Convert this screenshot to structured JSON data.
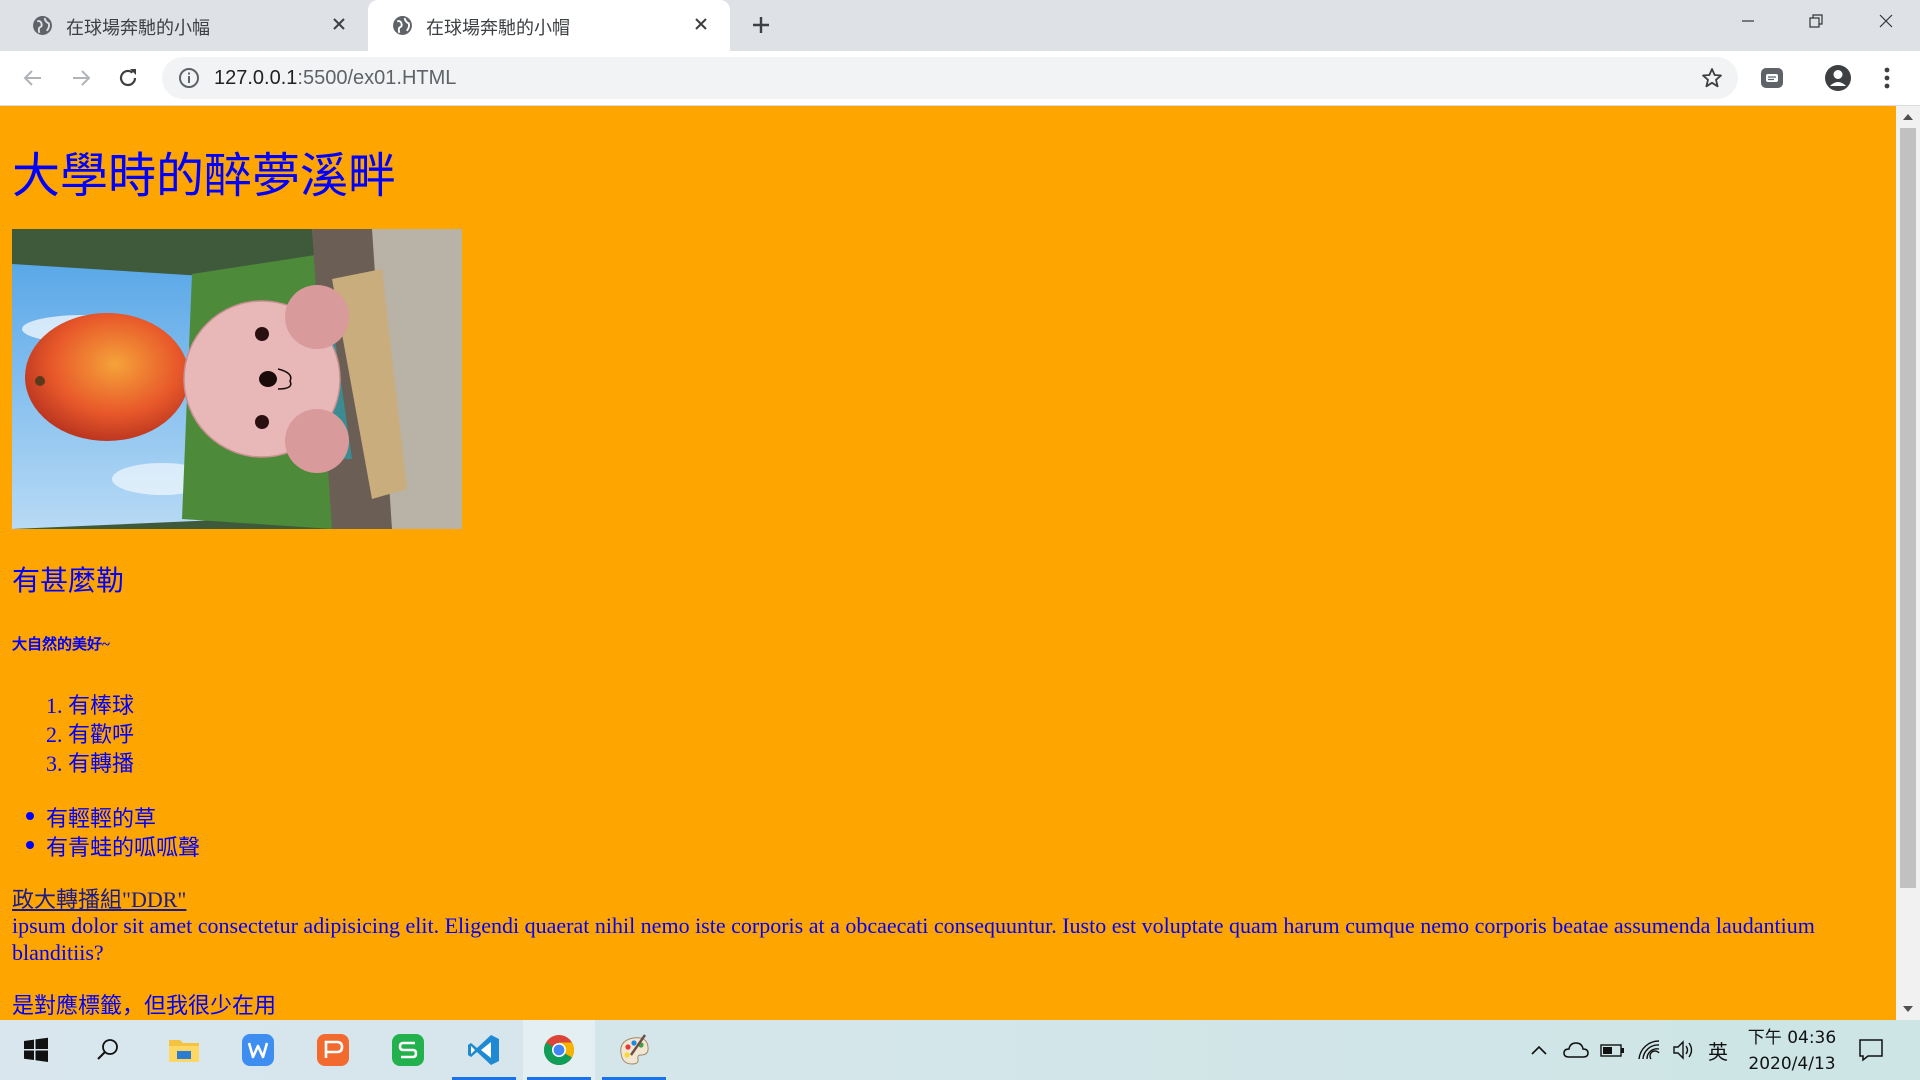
{
  "browser": {
    "tabs": [
      {
        "title": "在球場奔馳的小幅",
        "active": false
      },
      {
        "title": "在球場奔馳的小帽",
        "active": true
      }
    ],
    "url": {
      "host": "127.0.0.1",
      "rest": ":5500/ex01.HTML"
    }
  },
  "page": {
    "background": "#ffa500",
    "text_color": "#0000ff",
    "heading1": "大學時的醉夢溪畔",
    "heading2": "有甚麼勒",
    "heading6": "大自然的美好~",
    "ordered_list": [
      "1. 有棒球",
      "2. 有歡呼",
      "3. 有轉播"
    ],
    "unordered_list": [
      "有輕輕的草",
      "有青蛙的呱呱聲"
    ],
    "link_text": "政大轉播組\"DDR\"",
    "paragraph": "ipsum dolor sit amet consectetur adipisicing elit. Eligendi quaerat nihil nemo iste corporis at a obcaecati consequuntur. Iusto est voluptate quam harum cumque nemo corporis beatae assumenda laudantium blanditiis?",
    "note": "是對應標籤，但我很少在用"
  },
  "taskbar": {
    "apps": [
      "start-menu",
      "search",
      "file-explorer",
      "wps-writer",
      "wps-presentation",
      "wps-spreadsheet",
      "vscode",
      "chrome",
      "paint"
    ],
    "clock": {
      "time": "下午 04:36",
      "date": "2020/4/13"
    },
    "ime": "英"
  }
}
